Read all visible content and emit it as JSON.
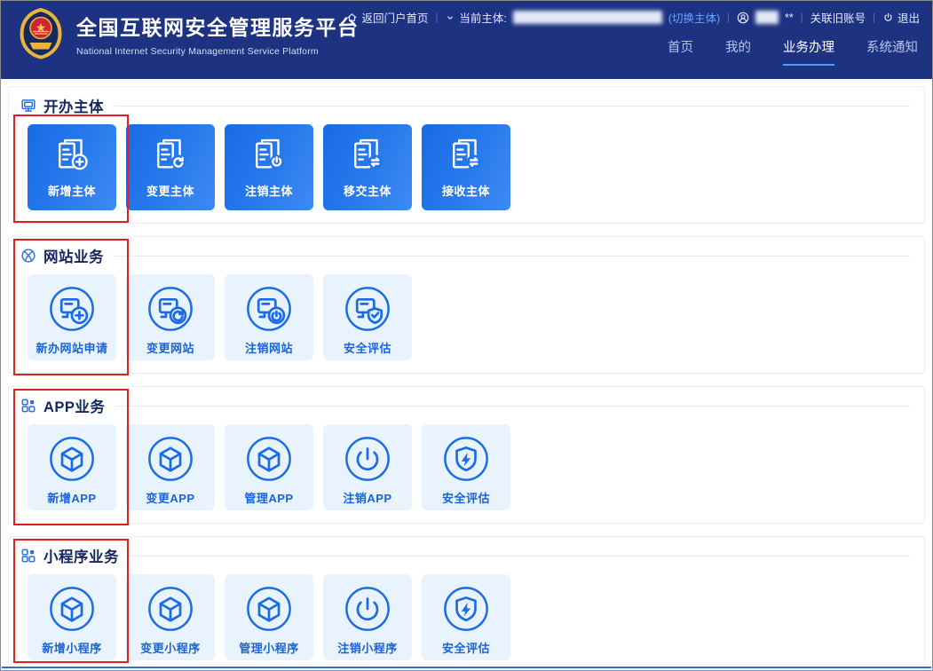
{
  "header": {
    "title": "全国互联网安全管理服务平台",
    "subtitle": "National Internet Security Management Service Platform",
    "topbar": {
      "home_link": "返回门户首页",
      "current_entity_label": "当前主体:",
      "switch_entity": "(切换主体)",
      "masked_suffix": "**",
      "link_old_account": "关联旧账号",
      "logout": "退出"
    },
    "nav": [
      {
        "label": "首页",
        "active": false
      },
      {
        "label": "我的",
        "active": false
      },
      {
        "label": "业务办理",
        "active": true
      },
      {
        "label": "系统通知",
        "active": false
      }
    ]
  },
  "colors": {
    "header_bg": "#1e3282",
    "accent_blue": "#1a6ce6",
    "card_gradient_start": "#1a6be4",
    "card_gradient_end": "#3f8af3",
    "light_card_bg": "#e8f3fd",
    "light_card_text": "#1a64d9",
    "nav_underline": "#4d9cf8",
    "highlight_red": "#e02020",
    "section_title": "#15265e"
  },
  "sections": [
    {
      "name": "business-entity",
      "title": "开办主体",
      "icon": "monitor-icon",
      "style": "solid",
      "highlighted": true,
      "highlight_includes_title": false,
      "cards": [
        {
          "name": "add-entity",
          "label": "新增主体",
          "icon": "entity-add-icon"
        },
        {
          "name": "change-entity",
          "label": "变更主体",
          "icon": "entity-refresh-icon"
        },
        {
          "name": "cancel-entity",
          "label": "注销主体",
          "icon": "entity-power-icon"
        },
        {
          "name": "transfer-entity",
          "label": "移交主体",
          "icon": "entity-transfer-icon"
        },
        {
          "name": "receive-entity",
          "label": "接收主体",
          "icon": "entity-receive-icon"
        }
      ]
    },
    {
      "name": "website-services",
      "title": "网站业务",
      "icon": "globe-icon",
      "style": "light",
      "highlighted": true,
      "highlight_includes_title": true,
      "cards": [
        {
          "name": "new-website-application",
          "label": "新办网站申请",
          "icon": "website-add-icon"
        },
        {
          "name": "change-website",
          "label": "变更网站",
          "icon": "website-refresh-icon"
        },
        {
          "name": "cancel-website",
          "label": "注销网站",
          "icon": "website-power-icon"
        },
        {
          "name": "security-assessment-website",
          "label": "安全评估",
          "icon": "website-shield-icon"
        }
      ]
    },
    {
      "name": "app-services",
      "title": "APP业务",
      "icon": "grid-icon",
      "style": "light",
      "highlighted": true,
      "highlight_includes_title": true,
      "cards": [
        {
          "name": "add-app",
          "label": "新增APP",
          "icon": "app-cube-icon"
        },
        {
          "name": "change-app",
          "label": "变更APP",
          "icon": "app-cube-icon"
        },
        {
          "name": "manage-app",
          "label": "管理APP",
          "icon": "app-cube-icon"
        },
        {
          "name": "cancel-app",
          "label": "注销APP",
          "icon": "power-circle-icon"
        },
        {
          "name": "security-assessment-app",
          "label": "安全评估",
          "icon": "shield-bolt-icon"
        }
      ]
    },
    {
      "name": "miniprogram-services",
      "title": "小程序业务",
      "icon": "grid-icon",
      "style": "light",
      "highlighted": true,
      "highlight_includes_title": true,
      "cards": [
        {
          "name": "add-miniprogram",
          "label": "新增小程序",
          "icon": "app-cube-icon"
        },
        {
          "name": "change-miniprogram",
          "label": "变更小程序",
          "icon": "app-cube-icon"
        },
        {
          "name": "manage-miniprogram",
          "label": "管理小程序",
          "icon": "app-cube-icon"
        },
        {
          "name": "cancel-miniprogram",
          "label": "注销小程序",
          "icon": "power-circle-icon"
        },
        {
          "name": "security-assessment-miniprogram",
          "label": "安全评估",
          "icon": "shield-bolt-icon"
        }
      ]
    }
  ]
}
